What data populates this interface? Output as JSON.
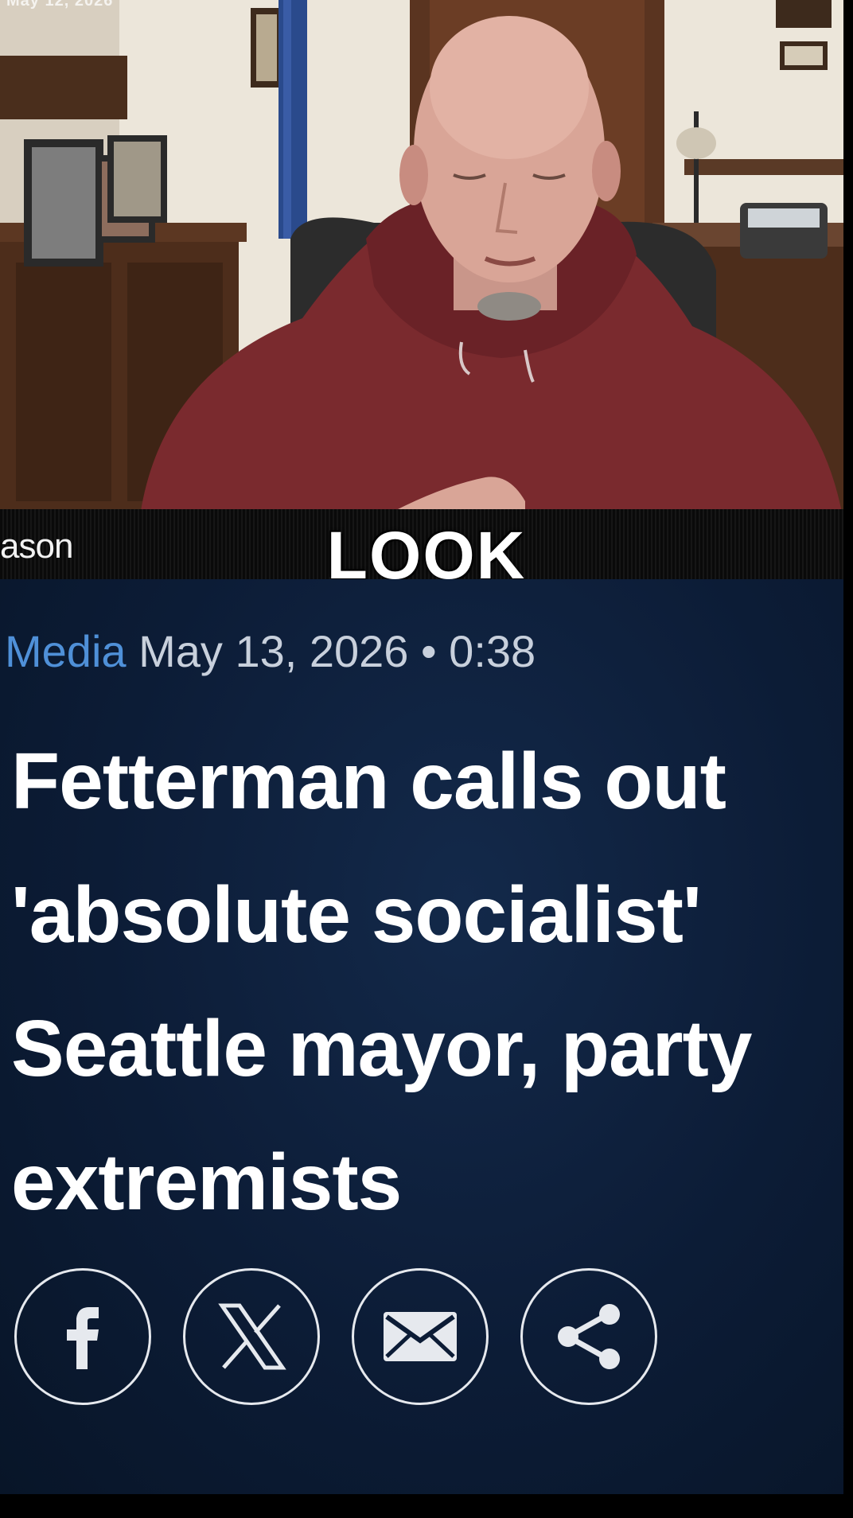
{
  "video": {
    "timestamp_overlay": "May 12, 2026",
    "lower_third_name": "ason",
    "caption": "LOOK"
  },
  "article": {
    "category": "Media",
    "date": "May 13, 2026",
    "separator": "•",
    "duration": "0:38",
    "headline_lines": [
      "Fetterman calls out",
      "'absolute socialist'",
      "Seattle mayor, party",
      "extremists"
    ]
  },
  "share": {
    "buttons": [
      {
        "icon": "facebook-icon"
      },
      {
        "icon": "x-icon"
      },
      {
        "icon": "email-icon"
      },
      {
        "icon": "share-icon"
      }
    ]
  },
  "colors": {
    "card_background": "#0c1c36",
    "category_link": "#4f90d8",
    "hoodie": "#7a2a2e",
    "text": "#ffffff"
  }
}
